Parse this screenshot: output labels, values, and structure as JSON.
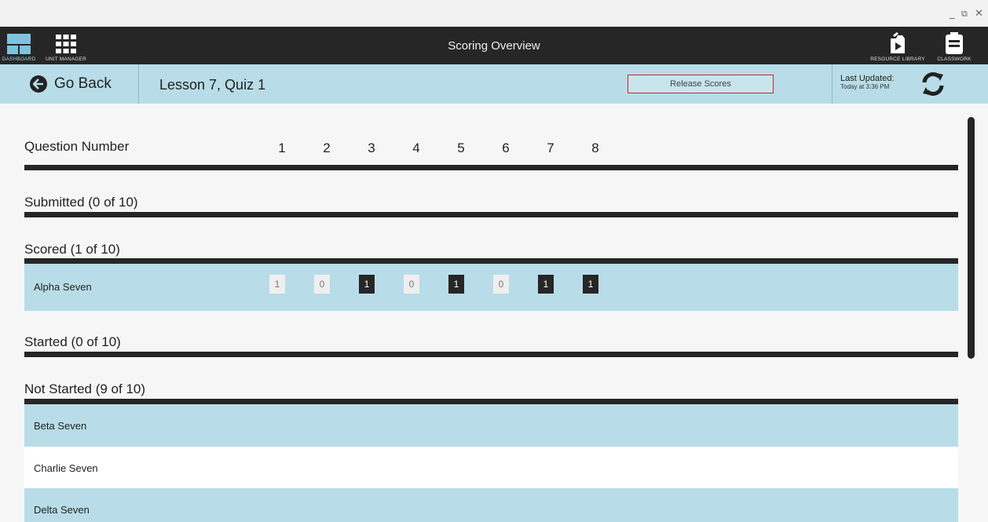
{
  "window": {
    "minimize": "_",
    "restore": "⧉",
    "close": "✕"
  },
  "header": {
    "title": "Scoring Overview",
    "nav_left": [
      {
        "label": "DASHBOARD",
        "icon": "dashboard-icon"
      },
      {
        "label": "UNIT MANAGER",
        "icon": "grid-icon"
      }
    ],
    "nav_right": [
      {
        "label": "RESOURCE LIBRARY",
        "icon": "resource-library-icon"
      },
      {
        "label": "CLASSWORK",
        "icon": "classwork-icon"
      }
    ]
  },
  "toolbar": {
    "back_label": "Go Back",
    "lesson_title": "Lesson 7, Quiz 1",
    "release_label": "Release Scores",
    "last_updated_label": "Last Updated:",
    "last_updated_time": "Today at 3:36 PM"
  },
  "questions": {
    "header_label": "Question Number",
    "numbers": [
      "1",
      "2",
      "3",
      "4",
      "5",
      "6",
      "7",
      "8"
    ]
  },
  "sections": {
    "submitted": {
      "title": "Submitted (0 of 10)"
    },
    "scored": {
      "title": "Scored (1 of 10)",
      "students": [
        {
          "name": "Alpha Seven",
          "scores": [
            "1",
            "0",
            "1",
            "0",
            "1",
            "0",
            "1",
            "1"
          ],
          "highlight": [
            false,
            false,
            true,
            false,
            true,
            false,
            true,
            true
          ]
        }
      ]
    },
    "started": {
      "title": "Started (0 of 10)"
    },
    "not_started": {
      "title": "Not Started (9 of 10)",
      "students": [
        "Beta Seven",
        "Charlie Seven",
        "Delta Seven"
      ]
    }
  },
  "colors": {
    "accent_row": "#b8dde8",
    "dark": "#262626",
    "release_border": "#c62828"
  }
}
